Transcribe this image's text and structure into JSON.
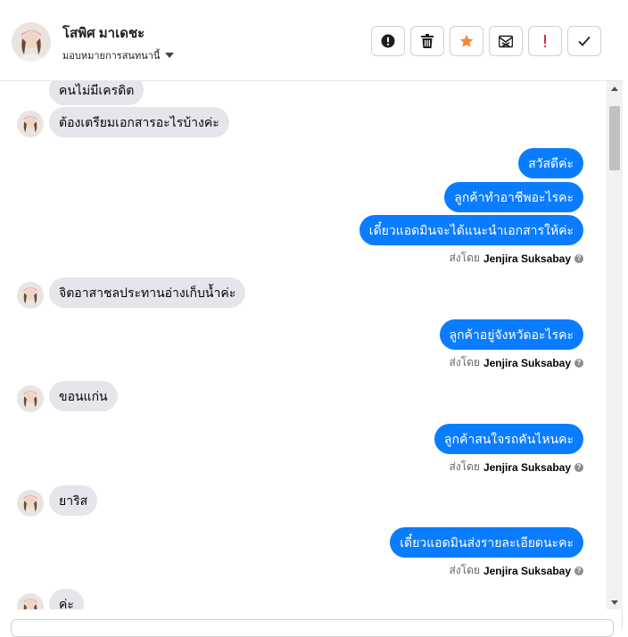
{
  "header": {
    "contact_name": "โสพิศ มาเดชะ",
    "assignee_label": "มอบหมายการสนทนานี้",
    "actions": [
      {
        "icon": "alert-circle-icon"
      },
      {
        "icon": "trash-icon"
      },
      {
        "icon": "star-icon",
        "color": "#f5893a"
      },
      {
        "icon": "mail-x-icon"
      },
      {
        "icon": "exclamation-icon",
        "color": "#e02f2f"
      },
      {
        "icon": "check-icon"
      }
    ]
  },
  "colors": {
    "outgoing": "#0a7cff",
    "incoming": "#e4e6eb"
  },
  "messages": {
    "m0": "คนไม่มีเครดิต",
    "m1": "ต้องเตรียมเอกสารอะไรบ้างค่ะ",
    "m2": "สวัสดีค่ะ",
    "m3": "ลูกค้าทำอาชีพอะไรคะ",
    "m4": "เดี๋ยวแอดมินจะได้แนะนำเอกสารให้ค่ะ",
    "m5": "จิตอาสาชลประทานอ่างเก็บน้ำค่ะ",
    "m6": "ลูกค้าอยู่จังหวัดอะไรคะ",
    "m7": "ขอนแก่น",
    "m8": "ลูกค้าสนใจรถคันไหนคะ",
    "m9": "ยาริส",
    "m10": "เดี๋ยวแอดมินส่งรายละเอียดนะคะ",
    "m11": "ค่ะ"
  },
  "sent_by": {
    "prefix": "ส่งโดย",
    "agent": "Jenjira Suksabay"
  }
}
